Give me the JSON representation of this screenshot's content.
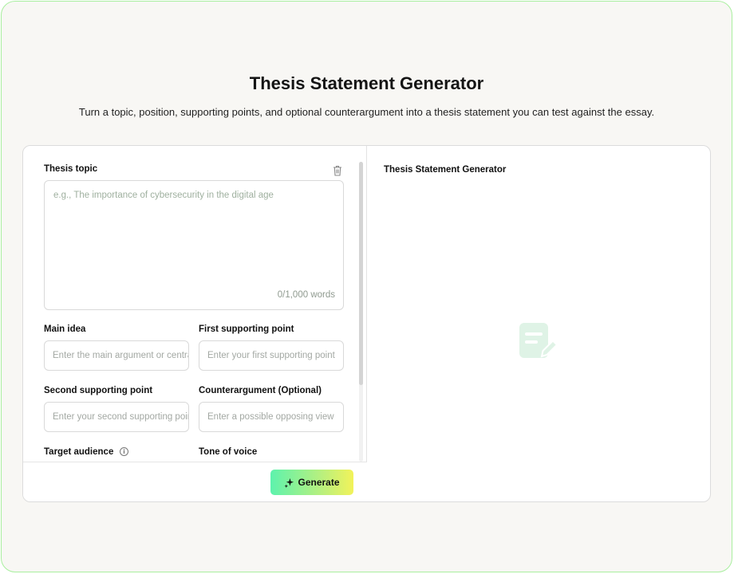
{
  "page": {
    "title": "Thesis Statement Generator",
    "subtitle": "Turn a topic, position, supporting points, and optional counterargument into a thesis statement you can test against the essay."
  },
  "form": {
    "topic_label": "Thesis topic",
    "topic_placeholder": "e.g., The importance of cybersecurity in the digital age",
    "word_count": "0/1,000 words",
    "main_idea_label": "Main idea",
    "main_idea_placeholder": "Enter the main argument or central claim",
    "first_point_label": "First supporting point",
    "first_point_placeholder": "Enter your first supporting point",
    "second_point_label": "Second supporting point",
    "second_point_placeholder": "Enter your second supporting point",
    "counter_label": "Counterargument (Optional)",
    "counter_placeholder": "Enter a possible opposing view",
    "audience_label": "Target audience",
    "tone_label": "Tone of voice",
    "generate_label": "Generate"
  },
  "output": {
    "title": "Thesis Statement Generator"
  },
  "icons": {
    "trash": "trash-icon",
    "info": "info-icon",
    "sparkle": "sparkle-icon",
    "document_edit": "document-edit-icon"
  },
  "colors": {
    "frame_border": "#a9ef9f",
    "accent_start": "#5df2ad",
    "accent_end": "#f2f25a",
    "empty_icon": "#dff3e6"
  }
}
